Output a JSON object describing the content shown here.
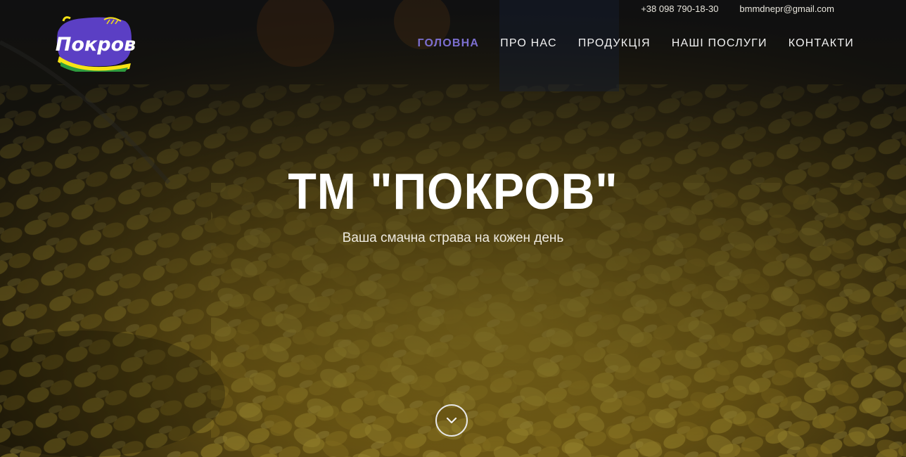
{
  "topbar": {
    "phone": "+38 098 790-18-30",
    "email": "bmmdnepr@gmail.com"
  },
  "brand": {
    "logo_text": "Покров",
    "logo_colors": [
      "#5b3fc4",
      "#f7e315",
      "#2e9b3e",
      "#ffffff"
    ]
  },
  "nav": {
    "items": [
      {
        "label": "ГОЛОВНА",
        "active": true
      },
      {
        "label": "ПРО НАС",
        "active": false
      },
      {
        "label": "ПРОДУКЦІЯ",
        "active": false
      },
      {
        "label": "НАШІ ПОСЛУГИ",
        "active": false
      },
      {
        "label": "КОНТАКТИ",
        "active": false
      }
    ],
    "active_color": "#7c6fd0"
  },
  "hero": {
    "title": "ТМ \"ПОКРОВ\"",
    "subtitle": "Ваша смачна страва на кожен день",
    "scroll_icon": "chevron-down-icon"
  }
}
